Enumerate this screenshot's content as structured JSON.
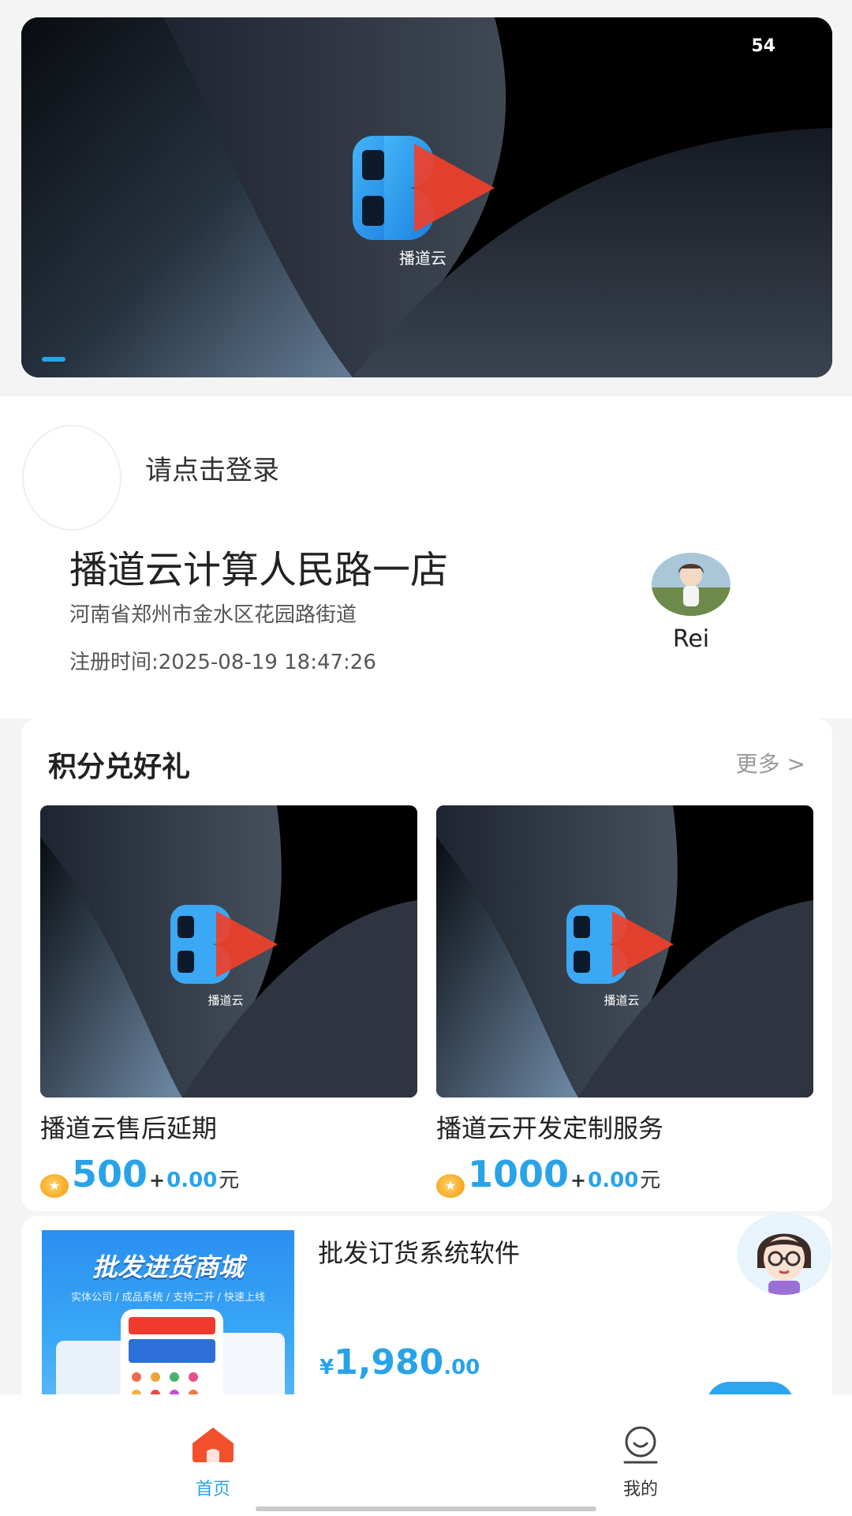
{
  "banner": {
    "counter": "54",
    "brand_caption": "播道云"
  },
  "login": {
    "prompt": "请点击登录"
  },
  "store": {
    "name": "播道云计算人民路一店",
    "address": "河南省郑州市金水区花园路街道",
    "register_time": "注册时间:2025-08-19 18:47:26",
    "user_name": "Rei"
  },
  "points_section": {
    "title": "积分兑好礼",
    "more_label": "更多 >",
    "products": [
      {
        "name": "播道云售后延期",
        "points": "500",
        "plus": "+",
        "cash": "0.00",
        "unit": "元",
        "brand_caption": "播道云"
      },
      {
        "name": "播道云开发定制服务",
        "points": "1000",
        "plus": "+",
        "cash": "0.00",
        "unit": "元",
        "brand_caption": "播道云"
      }
    ]
  },
  "listing": {
    "title": "批发订货系统软件",
    "thumb_title": "批发进货商城",
    "thumb_subtitle": "实体公司 / 成品系统 / 支持二开 / 快速上线",
    "price_symbol": "¥",
    "price_integer": "1,980",
    "price_decimal": ".00"
  },
  "nav": {
    "home_label": "首页",
    "mine_label": "我的"
  },
  "colors": {
    "accent": "#29a3e8",
    "home_icon": "#f2502d",
    "brand_blue": "#2f8ff0",
    "brand_red": "#f0402a"
  },
  "icons": {
    "home": "home-icon",
    "mine": "smile-user-icon",
    "coin": "coin-icon"
  }
}
